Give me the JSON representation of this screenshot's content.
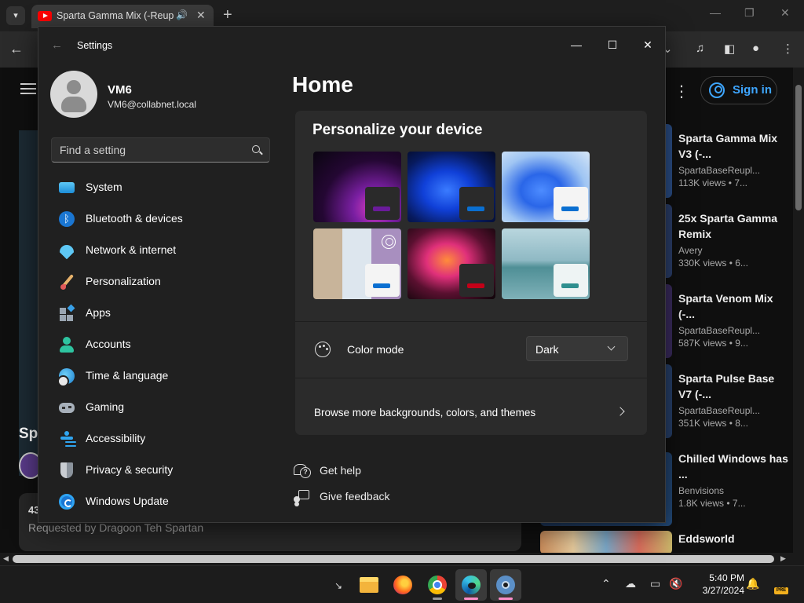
{
  "browser": {
    "tab_title": "Sparta Gamma Mix (-Reupload)",
    "new_tab_label": "+",
    "minimize_label": "—",
    "restore_label": "❐",
    "close_label": "✕",
    "back_label": "←"
  },
  "youtube": {
    "signin_label": "Sign in",
    "title_peek": "Sp",
    "desc_count": "43",
    "desc_text": "Requested by Dragoon Teh Spartan",
    "recommendations": [
      {
        "title": "Sparta Gamma Mix V3 (-...",
        "channel": "SpartaBaseReupl...",
        "meta": "113K views • 7..."
      },
      {
        "title": "25x Sparta Gamma Remix",
        "channel": "Avery",
        "meta": "330K views • 6..."
      },
      {
        "title": "Sparta Venom Mix (-...",
        "channel": "SpartaBaseReupl...",
        "meta": "587K views • 9..."
      },
      {
        "title": "Sparta Pulse Base V7 (-...",
        "channel": "SpartaBaseReupl...",
        "meta": "351K views • 8..."
      },
      {
        "title": "Chilled Windows has ...",
        "channel": "Benvisions",
        "meta": "1.8K views • 7..."
      },
      {
        "title": "Eddsworld",
        "channel": "",
        "meta": ""
      }
    ],
    "colors": {
      "accent": "#3ea6ff"
    }
  },
  "settings": {
    "app_title": "Settings",
    "window": {
      "minimize": "—",
      "maximize": "☐",
      "close": "✕"
    },
    "user": {
      "name": "VM6",
      "email": "VM6@collabnet.local"
    },
    "search": {
      "placeholder": "Find a setting"
    },
    "nav": [
      {
        "label": "System",
        "icon": "monitor-icon"
      },
      {
        "label": "Bluetooth & devices",
        "icon": "bluetooth-icon"
      },
      {
        "label": "Network & internet",
        "icon": "wifi-icon"
      },
      {
        "label": "Personalization",
        "icon": "brush-icon"
      },
      {
        "label": "Apps",
        "icon": "apps-icon"
      },
      {
        "label": "Accounts",
        "icon": "person-icon"
      },
      {
        "label": "Time & language",
        "icon": "clock-globe-icon"
      },
      {
        "label": "Gaming",
        "icon": "gamepad-icon"
      },
      {
        "label": "Accessibility",
        "icon": "accessibility-icon"
      },
      {
        "label": "Privacy & security",
        "icon": "shield-icon"
      },
      {
        "label": "Windows Update",
        "icon": "update-icon"
      }
    ],
    "page_title": "Home",
    "personalize": {
      "title": "Personalize your device",
      "color_mode_label": "Color mode",
      "color_mode_value": "Dark",
      "browse_label": "Browse more backgrounds, colors, and themes",
      "theme_accents": [
        "#6a1b9a",
        "#0a6fd1",
        "#0a6fd1",
        "#0a6fd1",
        "#c40018",
        "#2f8f8f"
      ]
    },
    "links": {
      "help": "Get help",
      "feedback": "Give feedback"
    }
  },
  "taskbar": {
    "time": "5:40 PM",
    "date": "3/27/2024",
    "badge": "PRE"
  }
}
